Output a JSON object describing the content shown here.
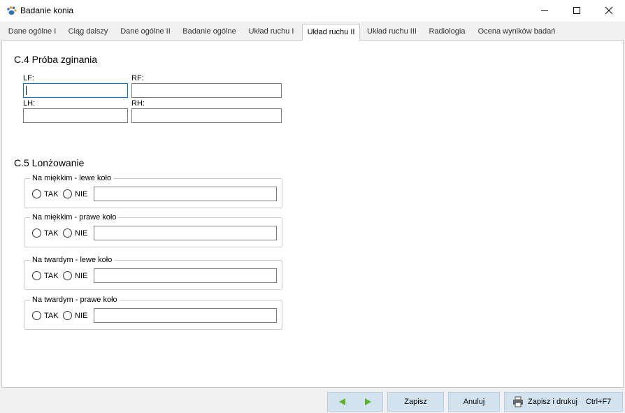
{
  "window": {
    "title": "Badanie konia"
  },
  "tabs": [
    {
      "label": "Dane ogólne I"
    },
    {
      "label": "Ciąg dalszy"
    },
    {
      "label": "Dane ogólne II"
    },
    {
      "label": "Badanie ogólne"
    },
    {
      "label": "Układ ruchu I"
    },
    {
      "label": "Układ ruchu II"
    },
    {
      "label": "Układ ruchu III"
    },
    {
      "label": "Radiologia"
    },
    {
      "label": "Ocena wyników badań"
    }
  ],
  "active_tab": "Układ ruchu II",
  "c4": {
    "title": "C.4 Próba zginania",
    "lf_label": "LF:",
    "lf_value": "",
    "rf_label": "RF:",
    "rf_value": "",
    "lh_label": "LH:",
    "lh_value": "",
    "rh_label": "RH:",
    "rh_value": ""
  },
  "c5": {
    "title": "C.5  Lonżowanie",
    "groups": [
      {
        "legend": "Na miękkim - lewe koło",
        "yes": "TAK",
        "no": "NIE",
        "note": ""
      },
      {
        "legend": "Na miękkim - prawe koło",
        "yes": "TAK",
        "no": "NIE",
        "note": ""
      },
      {
        "legend": "Na twardym - lewe koło",
        "yes": "TAK",
        "no": "NIE",
        "note": ""
      },
      {
        "legend": "Na twardym - prawe koło",
        "yes": "TAK",
        "no": "NIE",
        "note": ""
      }
    ]
  },
  "footer": {
    "save": "Zapisz",
    "cancel": "Anuluj",
    "save_print": "Zapisz i drukuj",
    "shortcut": "Ctrl+F7"
  },
  "colors": {
    "accent": "#0078d7",
    "nav_arrow": "#5ab42a",
    "footer_button": "#d3e2ef"
  }
}
